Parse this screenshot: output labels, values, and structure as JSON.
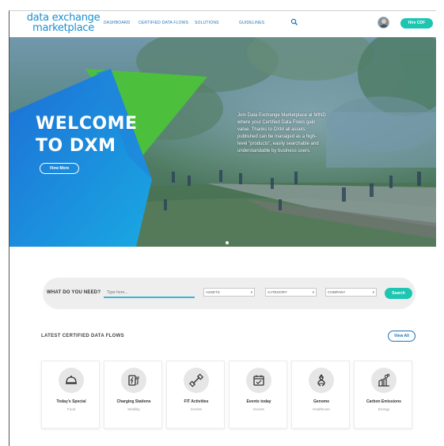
{
  "header": {
    "logo_line1": "data exchange",
    "logo_line2": "marketplace",
    "nav": [
      "DASHBOARD",
      "CERTIFIED DATA FLOWS",
      "SOLUTIONS",
      "GUIDELINES"
    ],
    "cta_label": "Hire CDF",
    "search_icon": "search-icon",
    "avatar_icon": "user-avatar"
  },
  "hero": {
    "welcome_line1": "WELCOME",
    "welcome_line2": "TO DXM",
    "view_more_label": "View More",
    "description": "Join Data Exchange Marketplace at MIND where your Certified Data Flows gain value. Thanks to DXM all assets published can be managed as a high-level \"products\", easily searchable and understandable by business users.",
    "slides_shown": 1
  },
  "search": {
    "question": "WHAT DO YOU NEED?",
    "input_placeholder": "Type here...",
    "selects": [
      "ASSETS",
      "CATEGORY",
      "COMPANY"
    ],
    "button_label": "Search"
  },
  "latest": {
    "title": "LATEST CERTIFIED DATA FLOWS",
    "view_all_label": "View All",
    "cards": [
      {
        "title": "Today's Special",
        "category": "Food",
        "icon": "food-cloche-icon"
      },
      {
        "title": "Charging Stations",
        "category": "Mobility",
        "icon": "charging-station-icon"
      },
      {
        "title": "FIT Activities",
        "category": "Events",
        "icon": "dumbbell-icon"
      },
      {
        "title": "Events today",
        "category": "Events",
        "icon": "calendar-icon"
      },
      {
        "title": "Genome",
        "category": "Healthcare",
        "icon": "dna-icon"
      },
      {
        "title": "Carbon Emissions",
        "category": "Energy",
        "icon": "factory-icon"
      }
    ]
  },
  "colors": {
    "brand_blue": "#1a8fd0",
    "accent_teal": "#1cc6b0",
    "hero_green": "#4cc23a"
  }
}
